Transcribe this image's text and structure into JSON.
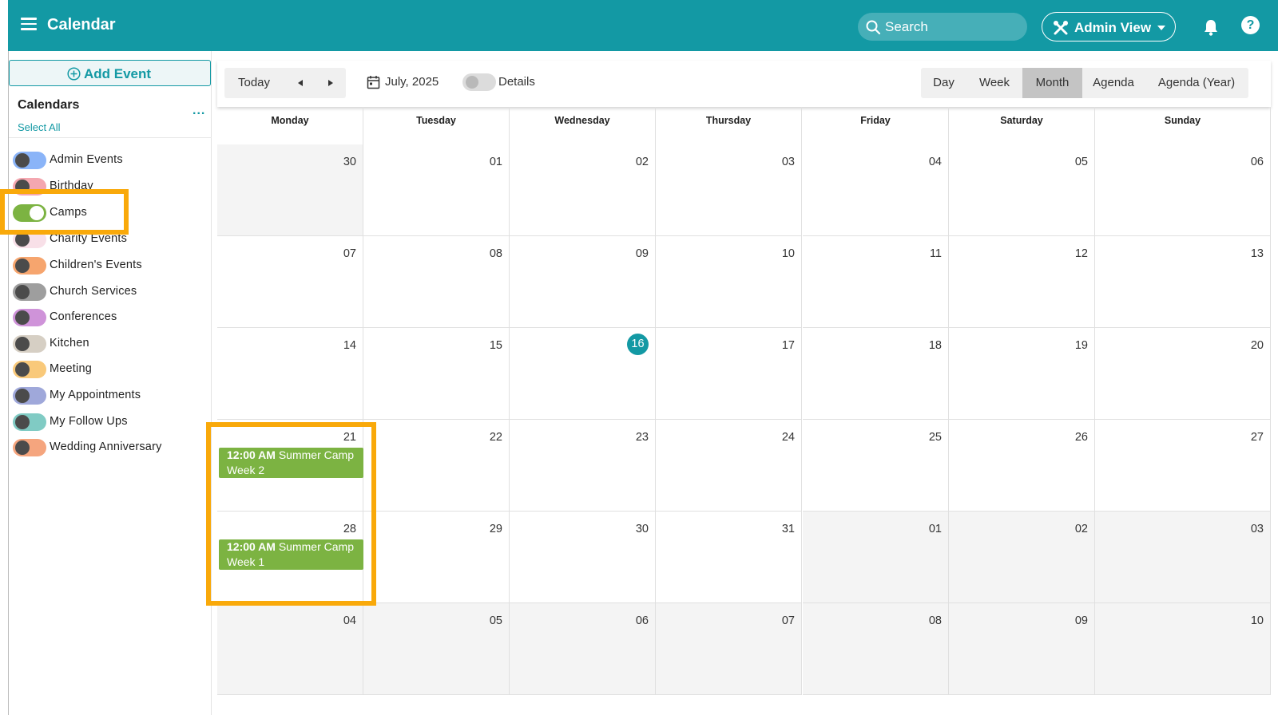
{
  "header": {
    "title": "Calendar",
    "search_placeholder": "Search",
    "admin_view_label": "Admin View",
    "help_label": "?"
  },
  "sidebar": {
    "add_event_label": "Add Event",
    "calendars_title": "Calendars",
    "select_all_label": "Select All",
    "more_label": "...",
    "calendars": [
      {
        "name": "Admin Events",
        "color": "#8ab4f8",
        "enabled": false
      },
      {
        "name": "Birthday",
        "color": "#f4a7b0",
        "enabled": false
      },
      {
        "name": "Camps",
        "color": "#7cb342",
        "enabled": true
      },
      {
        "name": "Charity Events",
        "color": "#f8e0e8",
        "enabled": false
      },
      {
        "name": "Children's Events",
        "color": "#f6a56e",
        "enabled": false
      },
      {
        "name": "Church Services",
        "color": "#9e9e9e",
        "enabled": false
      },
      {
        "name": "Conferences",
        "color": "#cf93d9",
        "enabled": false
      },
      {
        "name": "Kitchen",
        "color": "#d6cfc4",
        "enabled": false
      },
      {
        "name": "Meeting",
        "color": "#f9c97a",
        "enabled": false
      },
      {
        "name": "My Appointments",
        "color": "#9fa8da",
        "enabled": false
      },
      {
        "name": "My Follow Ups",
        "color": "#80cbc4",
        "enabled": false
      },
      {
        "name": "Wedding Anniversary",
        "color": "#f5a57e",
        "enabled": false
      }
    ]
  },
  "toolbar": {
    "today_label": "Today",
    "date_label": "July, 2025",
    "details_label": "Details",
    "views": [
      "Day",
      "Week",
      "Month",
      "Agenda",
      "Agenda (Year)"
    ],
    "active_view": "Month"
  },
  "calendar": {
    "day_headers": [
      "Monday",
      "Tuesday",
      "Wednesday",
      "Thursday",
      "Friday",
      "Saturday",
      "Sunday"
    ],
    "weeks": [
      [
        "30",
        "01",
        "02",
        "03",
        "04",
        "05",
        "06"
      ],
      [
        "07",
        "08",
        "09",
        "10",
        "11",
        "12",
        "13"
      ],
      [
        "14",
        "15",
        "16",
        "17",
        "18",
        "19",
        "20"
      ],
      [
        "21",
        "22",
        "23",
        "24",
        "25",
        "26",
        "27"
      ],
      [
        "28",
        "29",
        "30",
        "31",
        "01",
        "02",
        "03"
      ],
      [
        "04",
        "05",
        "06",
        "07",
        "08",
        "09",
        "10"
      ]
    ],
    "today": "16",
    "events": [
      {
        "week": 3,
        "day": 0,
        "time": "12:00 AM",
        "title": "Summer Camp Week 2"
      },
      {
        "week": 4,
        "day": 0,
        "time": "12:00 AM",
        "title": "Summer Camp Week 1"
      }
    ]
  },
  "colors": {
    "brand": "#1399a4",
    "highlight": "#f9a90a",
    "event": "#7cb342"
  }
}
